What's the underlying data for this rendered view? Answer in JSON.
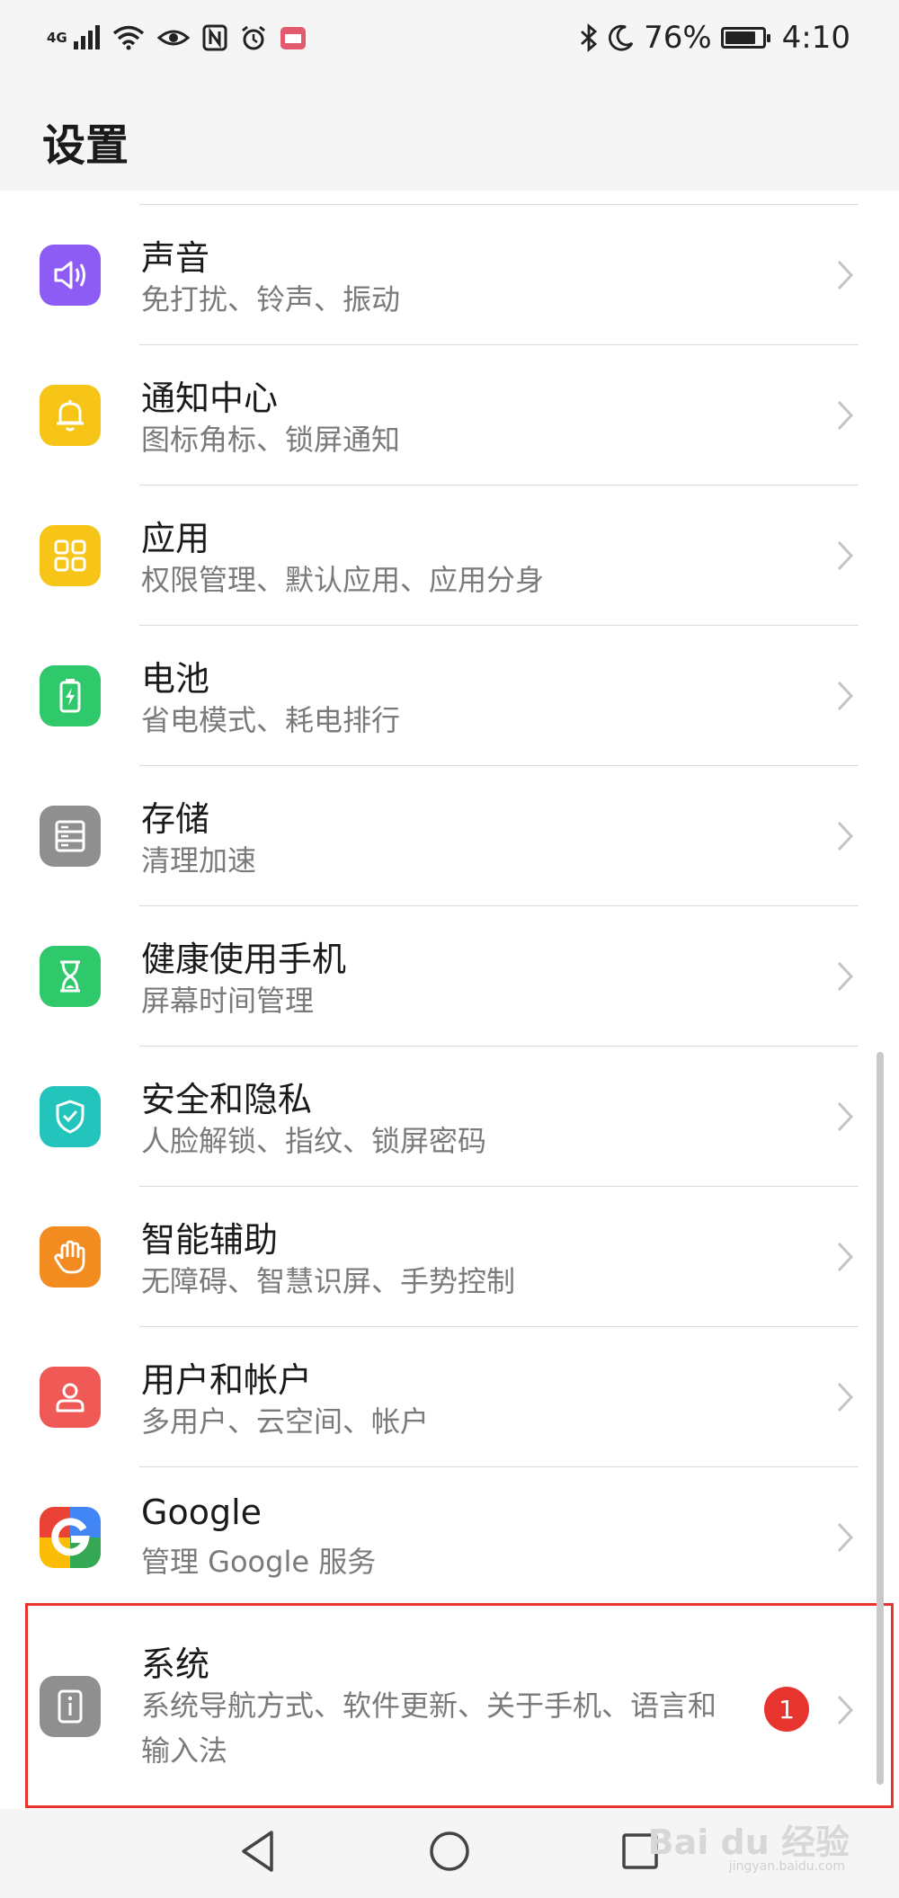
{
  "status_bar": {
    "network": "4G",
    "battery_percent": "76%",
    "battery_level": 0.76,
    "time": "4:10"
  },
  "header": {
    "title": "设置"
  },
  "items": [
    {
      "title": "声音",
      "subtitle": "免打扰、铃声、振动",
      "icon": "speaker-icon",
      "color": "#8c5cf5"
    },
    {
      "title": "通知中心",
      "subtitle": "图标角标、锁屏通知",
      "icon": "bell-icon",
      "color": "#f6c518"
    },
    {
      "title": "应用",
      "subtitle": "权限管理、默认应用、应用分身",
      "icon": "apps-grid-icon",
      "color": "#f6c518"
    },
    {
      "title": "电池",
      "subtitle": "省电模式、耗电排行",
      "icon": "battery-bolt-icon",
      "color": "#2fc86a"
    },
    {
      "title": "存储",
      "subtitle": "清理加速",
      "icon": "storage-icon",
      "color": "#8f8f8f"
    },
    {
      "title": "健康使用手机",
      "subtitle": "屏幕时间管理",
      "icon": "hourglass-icon",
      "color": "#2fc86a"
    },
    {
      "title": "安全和隐私",
      "subtitle": "人脸解锁、指纹、锁屏密码",
      "icon": "shield-icon",
      "color": "#22c4bb"
    },
    {
      "title": "智能辅助",
      "subtitle": "无障碍、智慧识屏、手势控制",
      "icon": "hand-icon",
      "color": "#f28c20"
    },
    {
      "title": "用户和帐户",
      "subtitle": "多用户、云空间、帐户",
      "icon": "user-icon",
      "color": "#ef5a57"
    },
    {
      "title": "Google",
      "subtitle": "管理 Google 服务",
      "icon": "google-icon",
      "color": "#ffffff"
    },
    {
      "title": "系统",
      "subtitle": "系统导航方式、软件更新、关于手机、语言和输入法",
      "icon": "phone-info-icon",
      "color": "#8f8f8f",
      "badge": "1"
    }
  ],
  "watermark": {
    "brand": "Bai du 经验",
    "url": "jingyan.baidu.com"
  }
}
